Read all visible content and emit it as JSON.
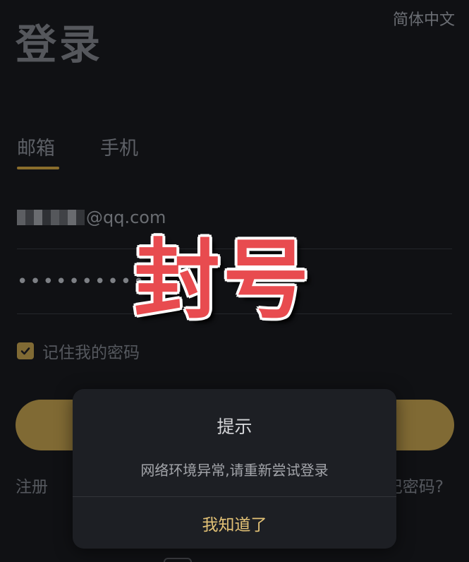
{
  "header": {
    "language": "简体中文",
    "title": "登录"
  },
  "tabs": [
    {
      "label": "邮箱",
      "active": true
    },
    {
      "label": "手机",
      "active": false
    }
  ],
  "form": {
    "email_value": "@qq.com",
    "password_mask": "••••••••••",
    "remember_label": "记住我的密码",
    "remember_checked": true
  },
  "links": {
    "register": "注册",
    "forgot_partial": "记密码?"
  },
  "overlay": {
    "stamp_text": "封号"
  },
  "dialog": {
    "title": "提示",
    "message": "网络环境异常,请重新尝试登录",
    "button": "我知道了"
  },
  "colors": {
    "accent": "#806a34",
    "stamp": "#e84b4f",
    "dialog_button": "#e3c276",
    "background": "#101114"
  }
}
